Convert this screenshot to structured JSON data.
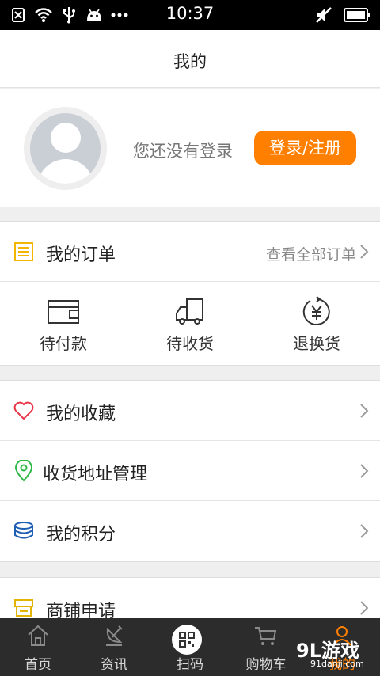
{
  "status_bar": {
    "time": "10:37",
    "icons": [
      "sim-blocked-icon",
      "wifi-icon",
      "usb-icon",
      "android-icon",
      "more-icon",
      "mute-icon",
      "battery-icon"
    ]
  },
  "header": {
    "title": "我的"
  },
  "profile": {
    "not_logged_in_text": "您还没有登录",
    "login_button": "登录/注册",
    "accent_color": "#ff7f00"
  },
  "orders": {
    "title": "我的订单",
    "view_all": "查看全部订单",
    "items": [
      {
        "label": "待付款",
        "icon": "wallet-icon"
      },
      {
        "label": "待收货",
        "icon": "truck-icon"
      },
      {
        "label": "退换货",
        "icon": "yuan-return-icon"
      }
    ]
  },
  "menu": {
    "favorites": "我的收藏",
    "address": "收货地址管理",
    "points": "我的积分",
    "shop_apply": "商铺申请"
  },
  "bottom_nav": [
    {
      "label": "首页",
      "icon": "home-icon"
    },
    {
      "label": "资讯",
      "icon": "news-icon"
    },
    {
      "label": "扫码",
      "icon": "qr-scan-icon"
    },
    {
      "label": "购物车",
      "icon": "cart-icon"
    },
    {
      "label": "我的",
      "icon": "user-icon"
    }
  ],
  "watermark": {
    "main": "9L游戏",
    "sub": "91danji.com"
  }
}
